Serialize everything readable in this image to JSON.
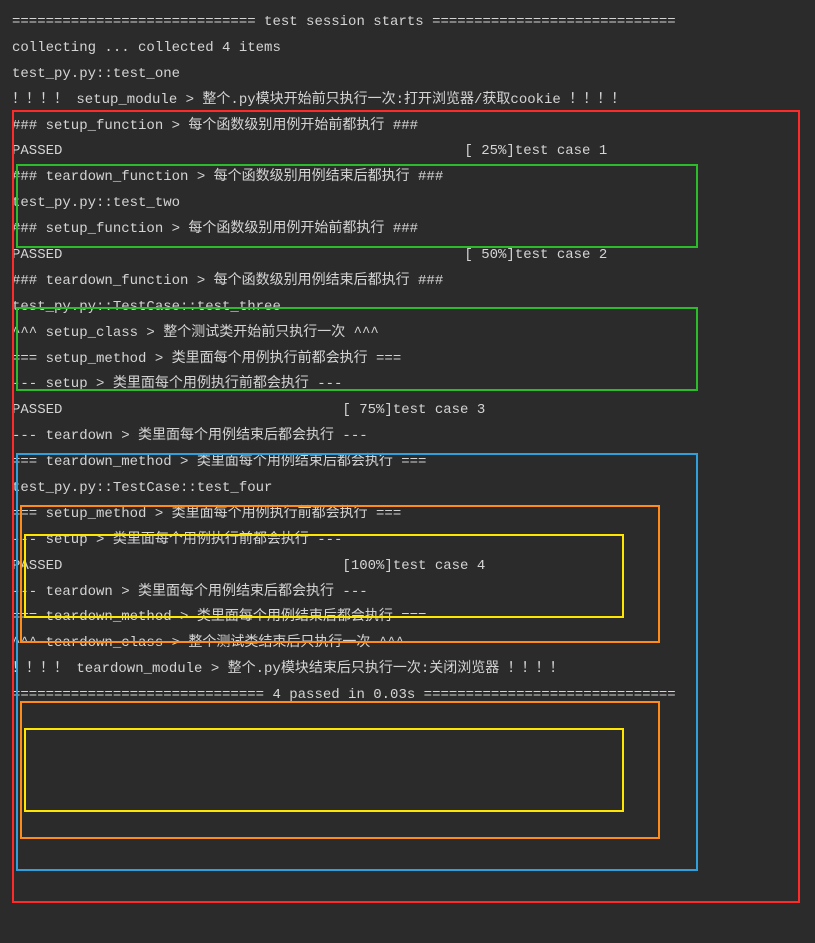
{
  "header": "============================= test session starts =============================",
  "collecting": "collecting ... collected 4 items",
  "blank": " ",
  "test1_name": "test_py.py::test_one",
  "setup_module": "！！！！ setup_module > 整个.py模块开始前只执行一次:打开浏览器/获取cookie ！！！！",
  "setup_function": "### setup_function > 每个函数级别用例开始前都执行 ###",
  "teardown_function": "### teardown_function > 每个函数级别用例结束后都执行 ###",
  "passed": "PASSED",
  "pct25": "[ 25%]",
  "tc1": "test case 1",
  "test2_name": "test_py.py::test_two",
  "pct50": "[ 50%]",
  "tc2": "test case 2",
  "test3_name": "test_py.py::TestCase::test_three",
  "setup_class": "^^^ setup_class > 整个测试类开始前只执行一次 ^^^",
  "setup_method": "=== setup_method > 类里面每个用例执行前都会执行 ===",
  "setup_inner": "--- setup > 类里面每个用例执行前都会执行 ---",
  "pct75": "[ 75%]",
  "tc3": "test case 3",
  "teardown_inner": "--- teardown > 类里面每个用例结束后都会执行 ---",
  "teardown_method": "=== teardown_method > 类里面每个用例结束后都会执行 ===",
  "test4_name": "test_py.py::TestCase::test_four",
  "pct100": "[100%]",
  "tc4": "test case 4",
  "teardown_class": "^^^ teardown_class > 整个测试类结束后只执行一次 ^^^",
  "teardown_module": "！！！！ teardown_module > 整个.py模块结束后只执行一次:关闭浏览器 ！！！！",
  "footer": "============================== 4 passed in 0.03s =============================="
}
